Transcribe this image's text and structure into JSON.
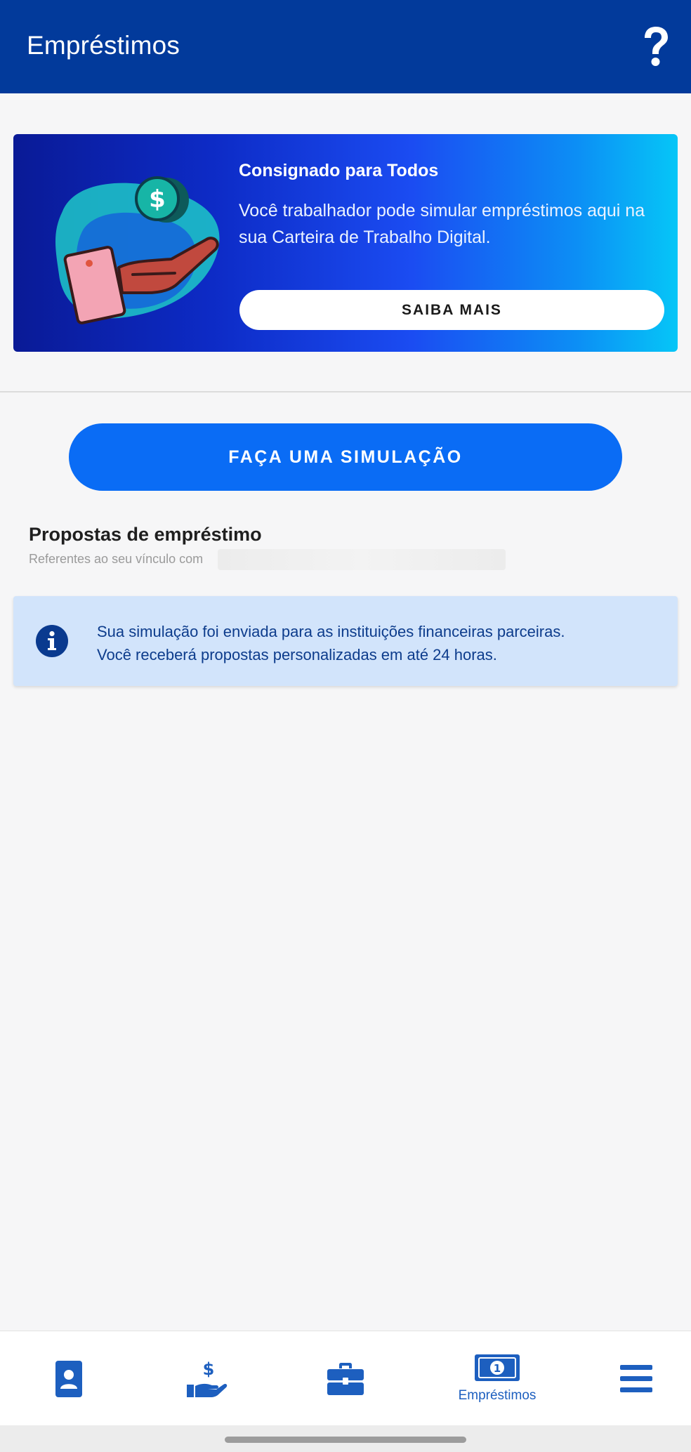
{
  "header": {
    "title": "Empréstimos",
    "help_icon": "question-mark-icon"
  },
  "banner": {
    "title": "Consignado para Todos",
    "text": "Você trabalhador pode simular empréstimos aqui na sua Carteira de Trabalho Digital.",
    "button_label": "SAIBA MAIS",
    "illustration": "hand-coin-phone-illustration"
  },
  "simulate_button_label": "FAÇA UMA SIMULAÇÃO",
  "proposals": {
    "title": "Propostas de empréstimo",
    "subtitle": "Referentes ao seu vínculo com"
  },
  "info_box": {
    "icon": "info-icon",
    "line1": "Sua simulação foi enviada para as instituições financeiras parceiras.",
    "line2": "Você receberá propostas personalizadas em até 24 horas."
  },
  "bottom_nav": {
    "items": [
      {
        "icon": "id-card-icon",
        "label": ""
      },
      {
        "icon": "hand-money-icon",
        "label": ""
      },
      {
        "icon": "briefcase-icon",
        "label": ""
      },
      {
        "icon": "banknote-icon",
        "label": "Empréstimos",
        "active": true
      },
      {
        "icon": "menu-icon",
        "label": ""
      }
    ]
  },
  "colors": {
    "header_bg": "#023a9b",
    "primary_button": "#0a6cf5",
    "info_bg": "#d2e4fb",
    "nav_icon": "#1d5fbf"
  }
}
